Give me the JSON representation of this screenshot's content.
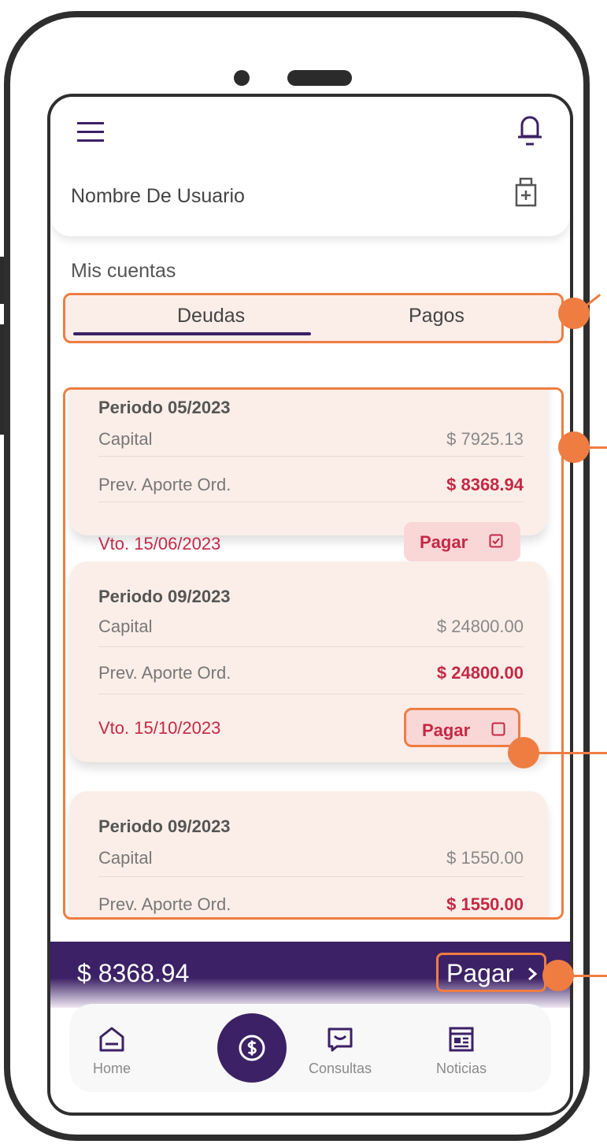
{
  "header": {
    "menu_icon": "hamburger-icon",
    "bell_icon": "bell-icon",
    "user_name": "Nombre De Usuario",
    "user_icon": "medical-kit-icon"
  },
  "section_title": "Mis cuentas",
  "tabs": [
    {
      "label": "Deudas",
      "active": true
    },
    {
      "label": "Pagos",
      "active": false
    }
  ],
  "cards": [
    {
      "period": "Periodo 05/2023",
      "capital_label": "Capital",
      "capital_value": "$ 7925.13",
      "aporte_label": "Prev. Aporte Ord.",
      "aporte_value": "$ 8368.94",
      "vto": "Vto. 15/06/2023",
      "pay_label": "Pagar",
      "selected": true
    },
    {
      "period": "Periodo 09/2023",
      "capital_label": "Capital",
      "capital_value": "$ 24800.00",
      "aporte_label": "Prev. Aporte Ord.",
      "aporte_value": "$ 24800.00",
      "vto": "Vto. 15/10/2023",
      "pay_label": "Pagar",
      "selected": false
    },
    {
      "period": "Periodo 09/2023",
      "capital_label": "Capital",
      "capital_value": "$ 1550.00",
      "aporte_label": "Prev. Aporte Ord.",
      "aporte_value": "$ 1550.00"
    }
  ],
  "paybar": {
    "total": "$ 8368.94",
    "pay_label": "Pagar"
  },
  "nav": {
    "home_label": "Home",
    "consultas_label": "Consultas",
    "noticias_label": "Noticias",
    "center_icon": "dollar-coin-icon"
  },
  "colors": {
    "brand_purple": "#3c2166",
    "annotation_orange": "#ef7d42",
    "debt_red": "#c62845",
    "card_bg": "#fbeee8"
  }
}
